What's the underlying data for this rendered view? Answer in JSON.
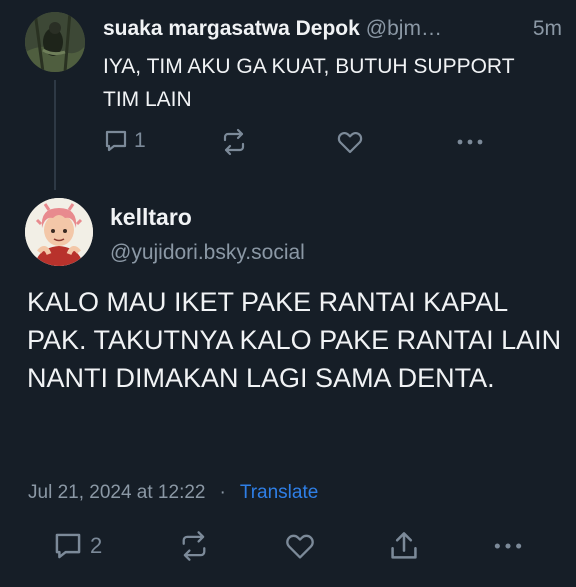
{
  "parent_post": {
    "display_name": "suaka margasatwa Depok",
    "handle": "@bjm…",
    "time": "5m",
    "text": "IYA, TIM AKU GA KUAT, BUTUH SUPPORT TIM LAIN",
    "reply_count": "1",
    "icons": [
      "reply-icon",
      "repost-icon",
      "like-icon",
      "more-icon"
    ]
  },
  "main_post": {
    "display_name": "kelltaro",
    "handle": "@yujidori.bsky.social",
    "text": "KALO MAU IKET PAKE RANTAI KAPAL PAK. TAKUTNYA KALO PAKE RANTAI LAIN NANTI DIMAKAN LAGI SAMA DENTA.",
    "timestamp": "Jul 21, 2024 at 12:22",
    "separator": "·",
    "translate_label": "Translate",
    "reply_count": "2",
    "icons": [
      "reply-icon",
      "repost-icon",
      "like-icon",
      "share-icon",
      "more-icon"
    ]
  },
  "colors": {
    "background": "#161e27",
    "text": "#f1f3f5",
    "muted": "#8b98a5",
    "link": "#2f7fe6",
    "icon": "#7c8a99"
  }
}
